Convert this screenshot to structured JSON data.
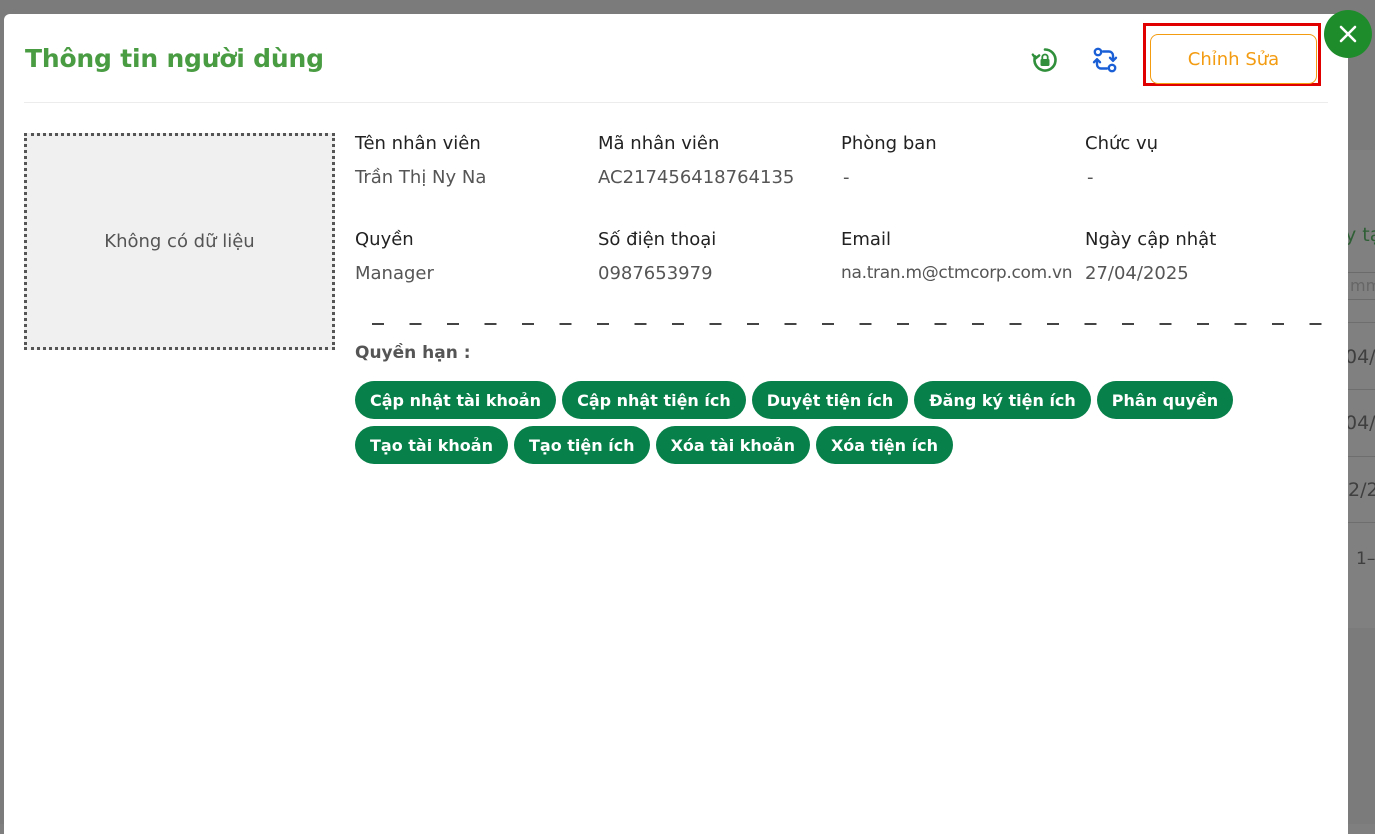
{
  "background": {
    "column_header_partial": "y tạ",
    "date_input_partial": "mm",
    "row_dates": [
      "04/",
      "04/",
      "2/2"
    ],
    "pagination_partial": "1–"
  },
  "modal": {
    "title": "Thông tin người dùng",
    "reset_icon": "lock-reset-icon",
    "sync_icon": "sync-icon",
    "edit_button": "Chỉnh Sửa",
    "close_icon": "close-icon",
    "avatar_empty_text": "Không có dữ liệu",
    "fields": {
      "name": {
        "label": "Tên nhân viên",
        "value": "Trần Thị Ny Na"
      },
      "code": {
        "label": "Mã nhân viên",
        "value": "AC217456418764135"
      },
      "department": {
        "label": "Phòng ban",
        "value": "-"
      },
      "position": {
        "label": "Chức vụ",
        "value": "-"
      },
      "role": {
        "label": "Quyền",
        "value": "Manager"
      },
      "phone": {
        "label": "Số điện thoại",
        "value": "0987653979"
      },
      "email": {
        "label": "Email",
        "value": "na.tran.m@ctmcorp.com.vn"
      },
      "updated": {
        "label": "Ngày cập nhật",
        "value": "27/04/2025"
      }
    },
    "permissions_label": "Quyền hạn :",
    "permissions": [
      "Cập nhật tài khoản",
      "Cập nhật tiện ích",
      "Duyệt tiện ích",
      "Đăng ký tiện ích",
      "Phân quyền",
      "Tạo tài khoản",
      "Tạo tiện ích",
      "Xóa tài khoản",
      "Xóa tiện ích"
    ]
  },
  "colors": {
    "title_green": "#4a9c43",
    "chip_green": "#08804a",
    "edit_orange": "#f39c12",
    "highlight_red": "#e00000",
    "close_green": "#1f8c2c",
    "sync_blue": "#1a5fd6"
  }
}
